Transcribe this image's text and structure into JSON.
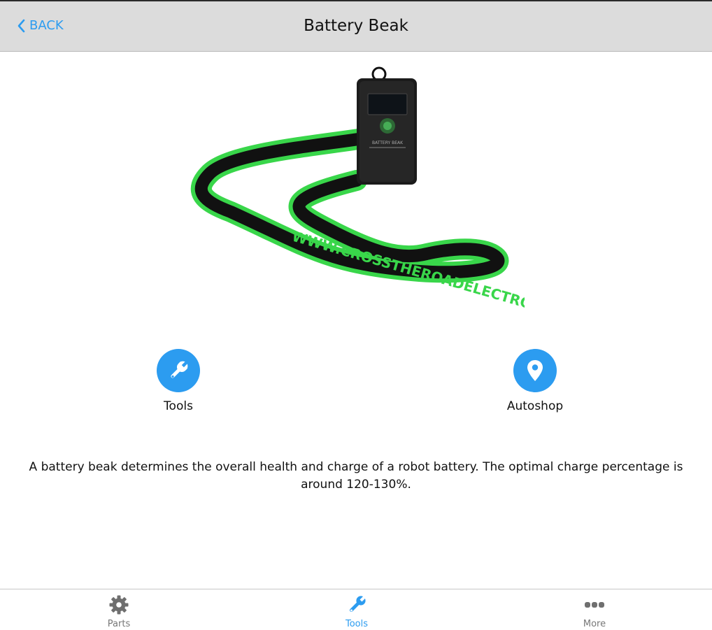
{
  "header": {
    "back_label": "BACK",
    "title": "Battery Beak"
  },
  "actions": [
    {
      "label": "Tools",
      "icon": "wrench-icon"
    },
    {
      "label": "Autoshop",
      "icon": "map-pin-icon"
    }
  ],
  "description": "A battery beak determines the overall health and charge of a robot battery.  The optimal charge percentage is around 120-130%.",
  "image": {
    "device_label": "BATTERY BEAK",
    "lanyard_text": "WWW.CROSSTHEROADELECTRONICS.COM"
  },
  "tabs": [
    {
      "label": "Parts",
      "icon": "gear-icon",
      "active": false
    },
    {
      "label": "Tools",
      "icon": "wrench-icon",
      "active": true
    },
    {
      "label": "More",
      "icon": "more-dots-icon",
      "active": false
    }
  ],
  "colors": {
    "accent": "#2c9cf0",
    "navbar": "#dcdcdc",
    "lanyard_green": "#39d64a",
    "inactive_tab": "#777777"
  }
}
